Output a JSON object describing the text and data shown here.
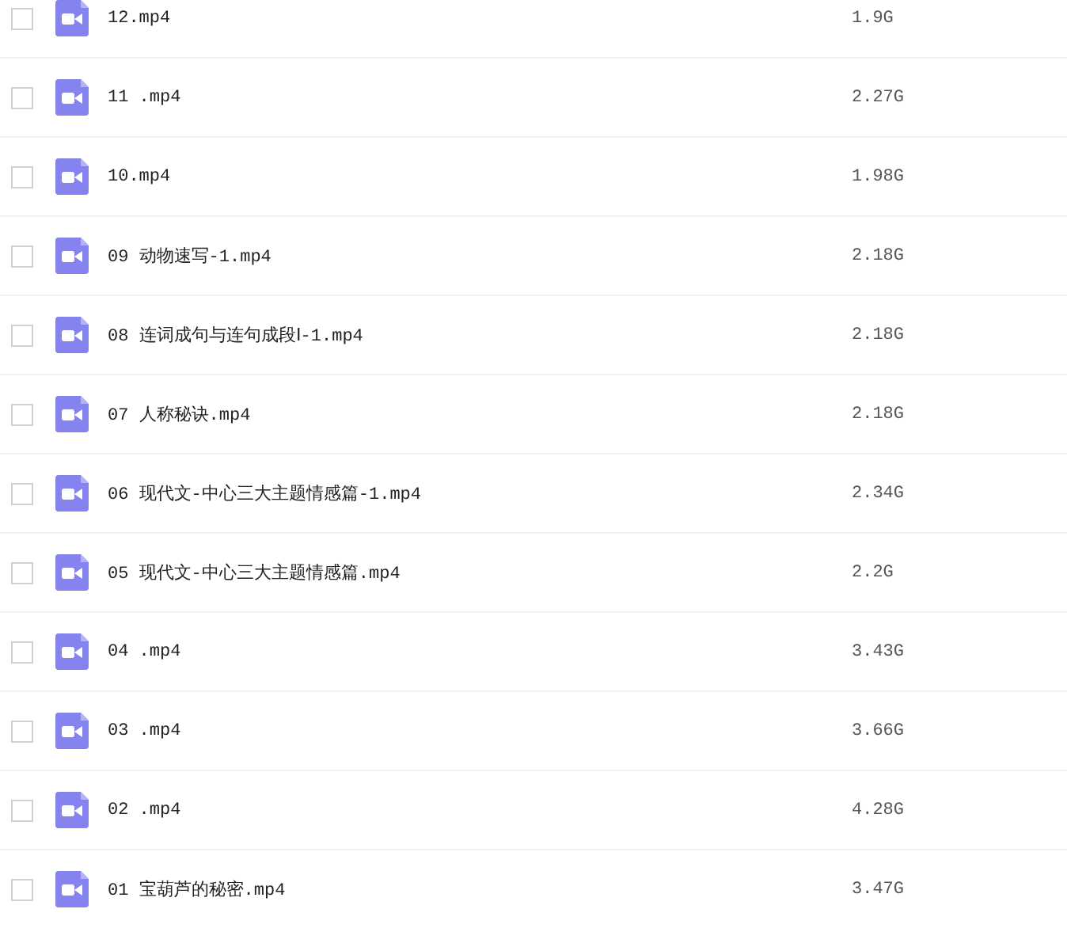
{
  "files": [
    {
      "name": "12.mp4",
      "size": "1.9G",
      "checked": false
    },
    {
      "name": "11 .mp4",
      "size": "2.27G",
      "checked": false
    },
    {
      "name": "10.mp4",
      "size": "1.98G",
      "checked": false
    },
    {
      "name": "09 动物速写-1.mp4",
      "size": "2.18G",
      "checked": false
    },
    {
      "name": "08 连词成句与连句成段Ⅰ-1.mp4",
      "size": "2.18G",
      "checked": false
    },
    {
      "name": "07 人称秘诀.mp4",
      "size": "2.18G",
      "checked": false
    },
    {
      "name": "06 现代文-中心三大主题情感篇-1.mp4",
      "size": "2.34G",
      "checked": false
    },
    {
      "name": "05 现代文-中心三大主题情感篇.mp4",
      "size": "2.2G",
      "checked": false
    },
    {
      "name": "04 .mp4",
      "size": "3.43G",
      "checked": false
    },
    {
      "name": "03 .mp4",
      "size": "3.66G",
      "checked": false
    },
    {
      "name": "02 .mp4",
      "size": "4.28G",
      "checked": false
    },
    {
      "name": "01 宝葫芦的秘密.mp4",
      "size": "3.47G",
      "checked": false
    }
  ]
}
